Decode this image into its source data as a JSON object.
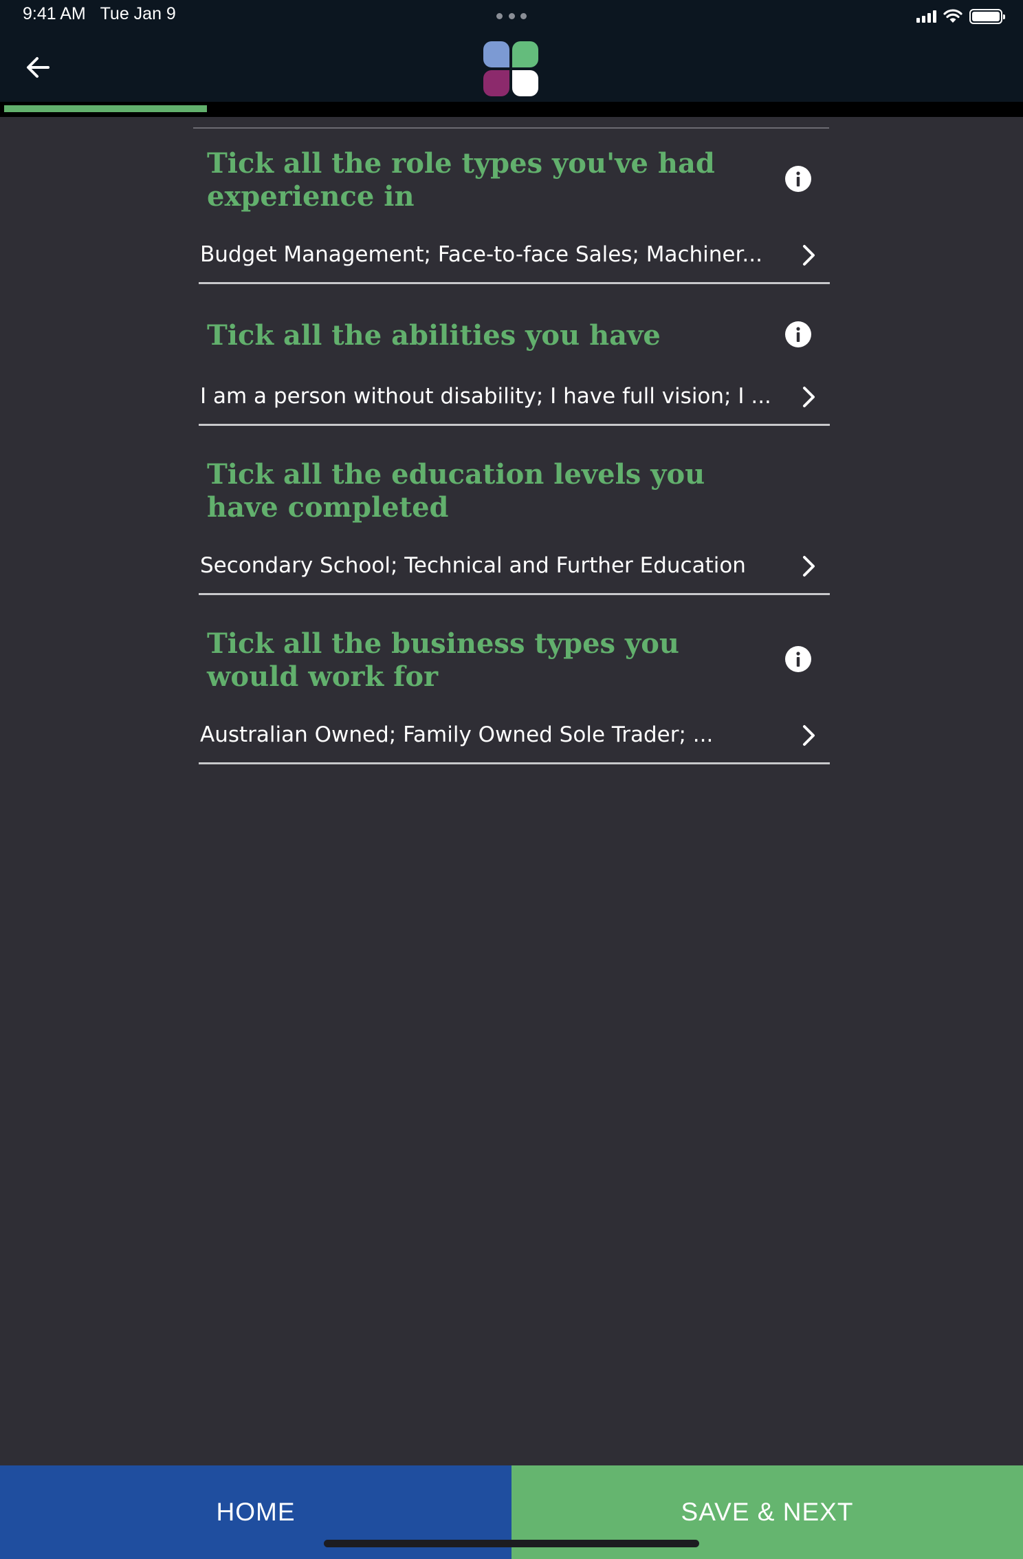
{
  "status_bar": {
    "time": "9:41 AM",
    "date": "Tue Jan 9"
  },
  "progress": {
    "fraction": 0.2
  },
  "sections": [
    {
      "title": "Tick all the role types you've had experience in",
      "value": "Budget Management; Face-to-face Sales; Machiner...",
      "has_info": true
    },
    {
      "title": "Tick all the abilities you have",
      "value": "I am a person without disability; I have full vision; I ...",
      "has_info": true
    },
    {
      "title": "Tick all the education levels you have completed",
      "value": "Secondary School; Technical and Further Education",
      "has_info": false
    },
    {
      "title": "Tick all the business types you would work for",
      "value": "Australian Owned; Family Owned Sole Trader; ...",
      "has_info": true
    }
  ],
  "bottom_bar": {
    "home_label": "HOME",
    "save_next_label": "SAVE & NEXT"
  },
  "icons": {
    "back": "arrow-left-icon",
    "info": "info-icon",
    "chevron": "chevron-right-icon"
  },
  "colors": {
    "accent_green": "#62b06d",
    "home_blue": "#1f4e9f",
    "save_green": "#65b56f",
    "logo_blue": "#7c9ad3",
    "logo_green": "#64bc7c",
    "logo_purple": "#8c2a6c",
    "background": "#2f2e35",
    "header": "#0c1620"
  }
}
